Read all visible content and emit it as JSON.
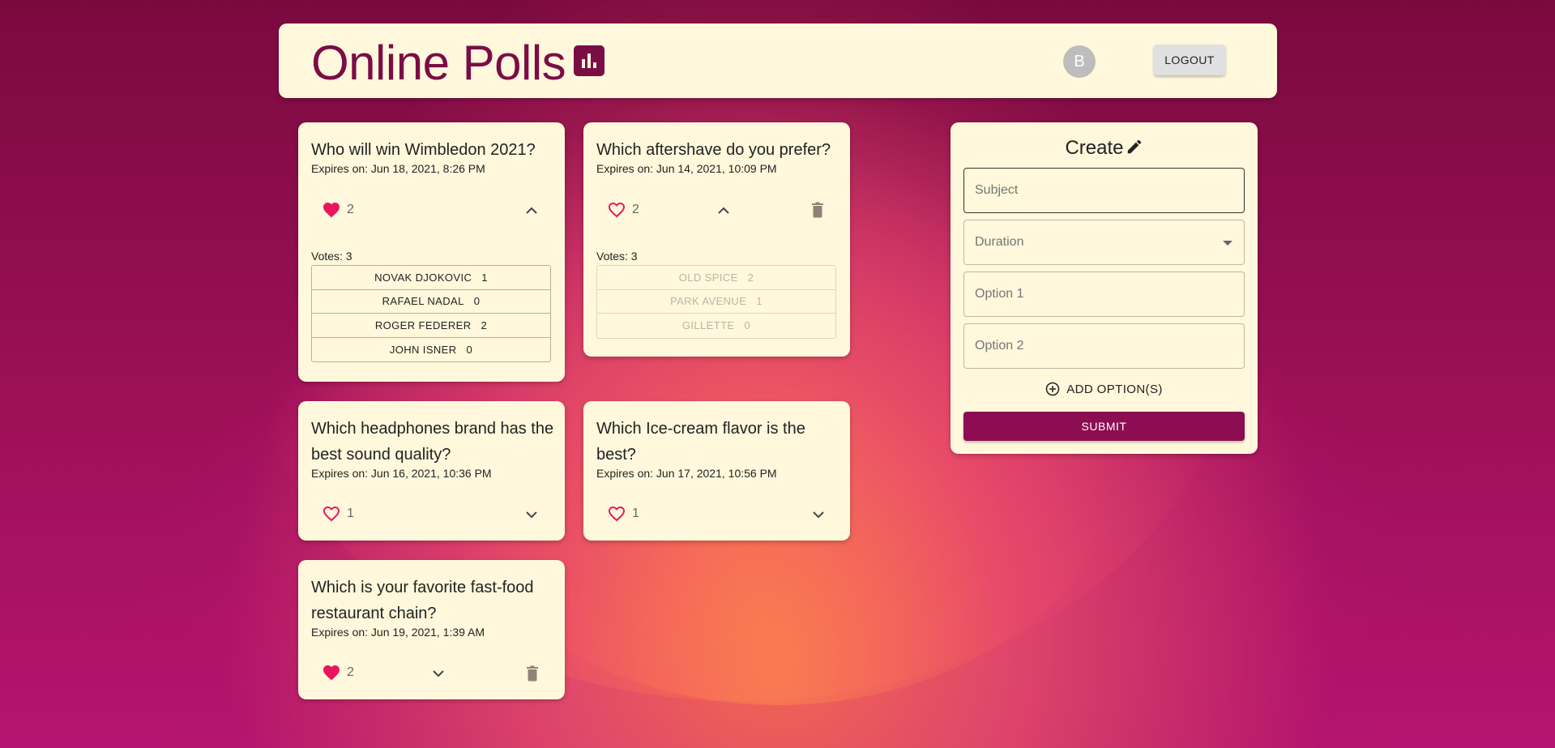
{
  "header": {
    "title": "Online Polls",
    "avatar_initial": "B",
    "logout_label": "LOGOUT"
  },
  "polls": [
    {
      "question": "Who will win Wimbledon 2021?",
      "expires": "Expires on: Jun 18, 2021, 8:26 PM",
      "likes": "2",
      "liked": true,
      "expanded": true,
      "deletable": false,
      "votes_label": "Votes: 3",
      "options": [
        {
          "label": "NOVAK DJOKOVIC",
          "count": "1"
        },
        {
          "label": "RAFAEL NADAL",
          "count": "0"
        },
        {
          "label": "ROGER FEDERER",
          "count": "2"
        },
        {
          "label": "JOHN ISNER",
          "count": "0"
        }
      ]
    },
    {
      "question": "Which aftershave do you prefer?",
      "expires": "Expires on: Jun 14, 2021, 10:09 PM",
      "likes": "2",
      "liked": false,
      "expanded": true,
      "deletable": true,
      "votes_label": "Votes: 3",
      "options": [
        {
          "label": "OLD SPICE",
          "count": "2"
        },
        {
          "label": "PARK AVENUE",
          "count": "1"
        },
        {
          "label": "GILLETTE",
          "count": "0"
        }
      ]
    },
    {
      "question": "Which headphones brand has the best sound quality?",
      "expires": "Expires on: Jun 16, 2021, 10:36 PM",
      "likes": "1",
      "liked": false,
      "expanded": false,
      "deletable": false
    },
    {
      "question": "Which Ice-cream flavor is the best?",
      "expires": "Expires on: Jun 17, 2021, 10:56 PM",
      "likes": "1",
      "liked": false,
      "expanded": false,
      "deletable": false
    },
    {
      "question": "Which is your favorite fast-food restaurant chain?",
      "expires": "Expires on: Jun 19, 2021, 1:39 AM",
      "likes": "2",
      "liked": true,
      "expanded": false,
      "deletable": true
    }
  ],
  "create": {
    "title": "Create",
    "subject_placeholder": "Subject",
    "duration_placeholder": "Duration",
    "option1_placeholder": "Option 1",
    "option2_placeholder": "Option 2",
    "add_options_label": "ADD OPTION(S)",
    "submit_label": "SUBMIT"
  },
  "colors": {
    "brand": "#7b0d45",
    "card_bg": "#fff8dc",
    "heart": "#e8175d",
    "submit": "#8c0d52"
  },
  "icons": {
    "title": "bar-chart-icon",
    "like": "heart-icon",
    "expand": "chevron-icon",
    "delete": "trash-icon",
    "create": "pencil-icon",
    "add": "plus-circle-icon"
  }
}
